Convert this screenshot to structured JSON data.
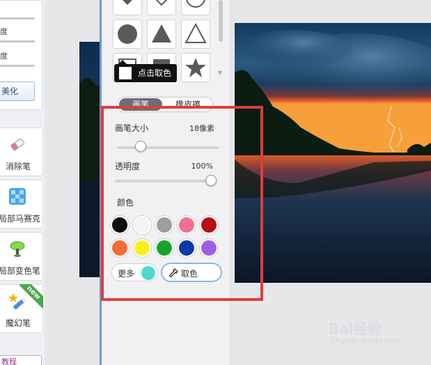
{
  "left_strip": {
    "slider_labels": [
      "度",
      "度"
    ],
    "beautify_label": "美化",
    "tools": [
      {
        "label": "消除笔",
        "icon": "eraser-icon"
      },
      {
        "label": "局部马赛克",
        "icon": "mosaic-icon"
      },
      {
        "label": "局部变色笔",
        "icon": "color-pen-icon"
      },
      {
        "label": "魔幻笔",
        "icon": "magic-pen-icon",
        "badge": "new"
      }
    ],
    "bottom_tab": "教程"
  },
  "panel": {
    "tooltip": "点击取色",
    "tabs": {
      "brush": "画笔",
      "eraser": "橡皮擦"
    },
    "brush_size": {
      "label": "画笔大小",
      "value": "18像素",
      "level": 0.2
    },
    "opacity": {
      "label": "透明度",
      "value": "100%",
      "level": 1.0
    },
    "color_label": "颜色",
    "colors": [
      "#0d0d0d",
      "#f4f4f6",
      "#9e9ea2",
      "#ef6f93",
      "#b30f14",
      "#f36b33",
      "#f8ef1c",
      "#16a52b",
      "#0d38a8",
      "#a05de6"
    ],
    "more_label": "更多",
    "more_color": "#4dd9cf",
    "pick_label": "取色"
  },
  "watermark": {
    "main": "Bai经验",
    "sub": "jingyan.baidu.com"
  }
}
